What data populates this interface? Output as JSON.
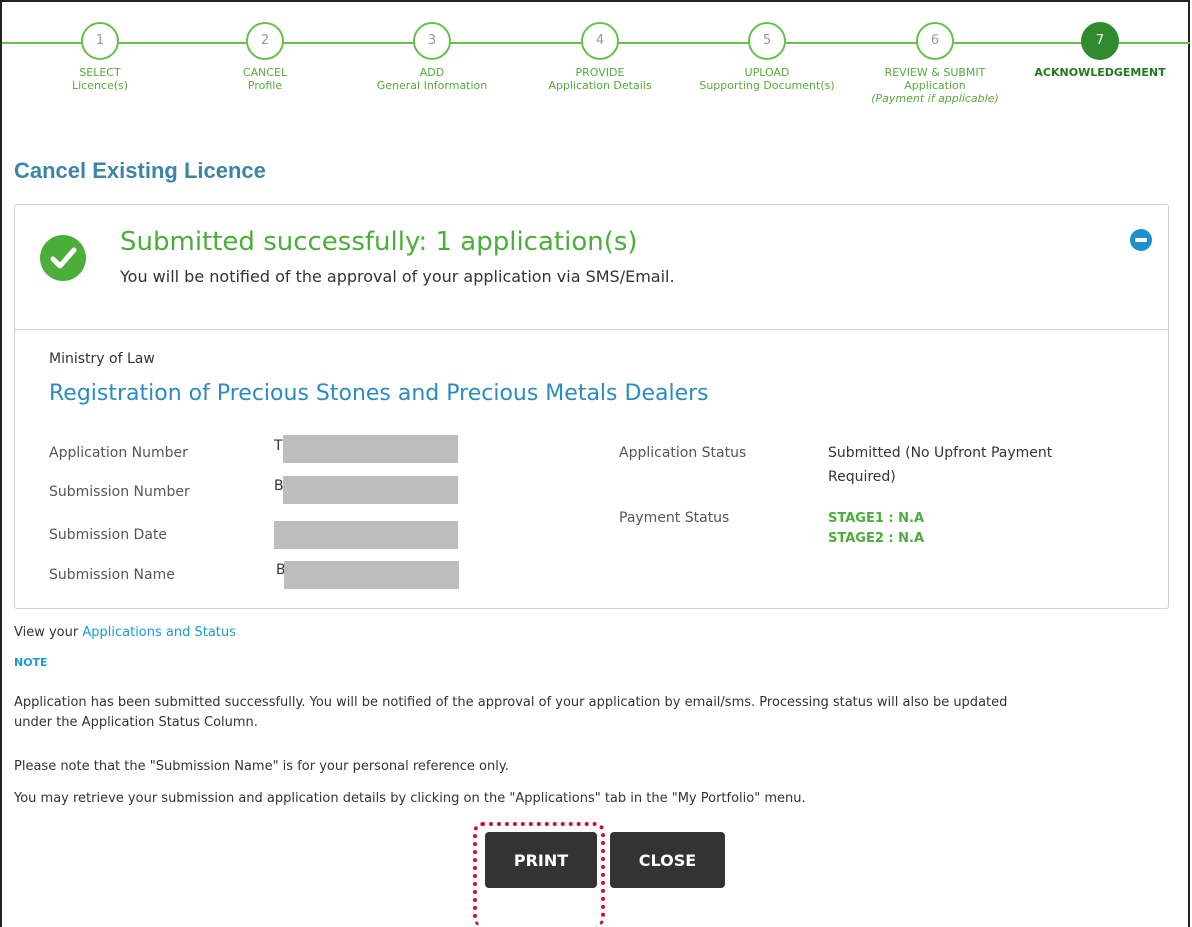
{
  "stepper": {
    "steps": [
      {
        "num": "1",
        "line1": "SELECT",
        "line2": "Licence(s)",
        "note": ""
      },
      {
        "num": "2",
        "line1": "CANCEL",
        "line2": "Profile",
        "note": ""
      },
      {
        "num": "3",
        "line1": "ADD",
        "line2": "General Information",
        "note": ""
      },
      {
        "num": "4",
        "line1": "PROVIDE",
        "line2": "Application Details",
        "note": ""
      },
      {
        "num": "5",
        "line1": "UPLOAD",
        "line2": "Supporting Document(s)",
        "note": ""
      },
      {
        "num": "6",
        "line1": "REVIEW & SUBMIT",
        "line2": "Application",
        "note": "(Payment if applicable)"
      },
      {
        "num": "7",
        "line1": "ACKNOWLEDGEMENT",
        "line2": "",
        "note": ""
      }
    ],
    "active_step": 7,
    "accent_color": "#6abf4b"
  },
  "page": {
    "title": "Cancel Existing Licence"
  },
  "result": {
    "title": "Submitted successfully: 1 application(s)",
    "subtitle": "You will be notified of the approval of your application via SMS/Email.",
    "color": "#4cae3a"
  },
  "details": {
    "ministry": "Ministry of Law",
    "service": "Registration of Precious Stones and Precious Metals Dealers",
    "application_number_label": "Application Number",
    "application_number_prefix": "T",
    "submission_number_label": "Submission Number",
    "submission_number_prefix": "B",
    "submission_date_label": "Submission Date",
    "submission_name_label": "Submission Name",
    "submission_name_prefix": "B",
    "application_status_label": "Application Status",
    "application_status_line1": "Submitted (No Upfront Payment",
    "application_status_line2": "Required)",
    "payment_status_label": "Payment Status",
    "payment_stage1": "STAGE1 : N.A",
    "payment_stage2": "STAGE2 : N.A"
  },
  "footer": {
    "view_prefix": "View your",
    "view_link": "Applications and Status",
    "note_heading": "NOTE",
    "note_line1a": "Application has been submitted successfully. You will be notified of the approval of your application by email/sms. Processing status will also be updated",
    "note_line1b": "under the Application Status Column.",
    "note_line2": "Please note that the \"Submission Name\" is for your personal reference only.",
    "note_line3": "You may retrieve your submission and application details by clicking on the \"Applications\" tab in the \"My Portfolio\" menu."
  },
  "buttons": {
    "print": "PRINT",
    "close": "CLOSE"
  }
}
